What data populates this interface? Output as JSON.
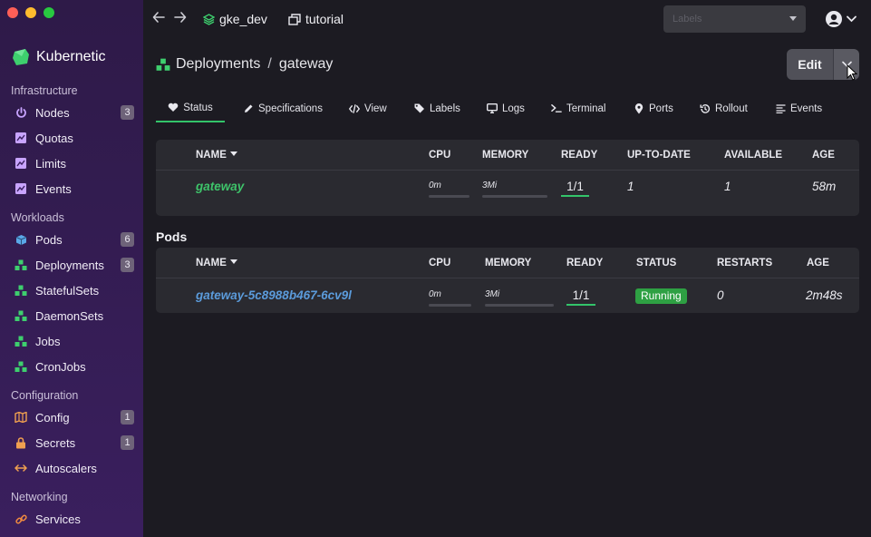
{
  "app": {
    "name": "Kubernetic"
  },
  "colors": {
    "accent": "#33c46a",
    "sidebar": "#3a1f5e",
    "link_green": "#3ec46a",
    "link_blue": "#5b9bdb",
    "running": "#2ea043"
  },
  "sidebar": {
    "sections": [
      {
        "label": "Infrastructure"
      },
      {
        "label": "Workloads"
      },
      {
        "label": "Configuration"
      },
      {
        "label": "Networking"
      }
    ],
    "items": [
      {
        "label": "Nodes",
        "count": "3",
        "icon": "power-icon"
      },
      {
        "label": "Quotas",
        "count": "",
        "icon": "chart-icon"
      },
      {
        "label": "Limits",
        "count": "",
        "icon": "chart-icon"
      },
      {
        "label": "Events",
        "count": "",
        "icon": "chart-icon"
      },
      {
        "label": "Pods",
        "count": "6",
        "icon": "cube-icon"
      },
      {
        "label": "Deployments",
        "count": "3",
        "icon": "cubes-icon"
      },
      {
        "label": "StatefulSets",
        "count": "",
        "icon": "cubes-icon"
      },
      {
        "label": "DaemonSets",
        "count": "",
        "icon": "cubes-icon"
      },
      {
        "label": "Jobs",
        "count": "",
        "icon": "cubes-icon"
      },
      {
        "label": "CronJobs",
        "count": "",
        "icon": "cubes-icon"
      },
      {
        "label": "Config",
        "count": "1",
        "icon": "map-icon"
      },
      {
        "label": "Secrets",
        "count": "1",
        "icon": "lock-icon"
      },
      {
        "label": "Autoscalers",
        "count": "",
        "icon": "arrows-h-icon"
      },
      {
        "label": "Services",
        "count": "",
        "icon": "link-icon"
      }
    ]
  },
  "topbar": {
    "context": "gke_dev",
    "namespace": "tutorial",
    "labels_placeholder": "Labels"
  },
  "header": {
    "kind": "Deployments",
    "separator": "/",
    "name": "gateway",
    "edit_label": "Edit"
  },
  "tabs": [
    {
      "label": "Status",
      "icon": "heartbeat-icon"
    },
    {
      "label": "Specifications",
      "icon": "pencil-icon"
    },
    {
      "label": "View",
      "icon": "code-icon"
    },
    {
      "label": "Labels",
      "icon": "tags-icon"
    },
    {
      "label": "Logs",
      "icon": "monitor-icon"
    },
    {
      "label": "Terminal",
      "icon": "terminal-icon"
    },
    {
      "label": "Ports",
      "icon": "pin-icon"
    },
    {
      "label": "Rollout",
      "icon": "history-icon"
    },
    {
      "label": "Events",
      "icon": "list-icon"
    }
  ],
  "deployment_table": {
    "headers": [
      "NAME",
      "CPU",
      "MEMORY",
      "READY",
      "UP-TO-DATE",
      "AVAILABLE",
      "AGE"
    ],
    "row": {
      "name": "gateway",
      "cpu": "0m",
      "memory": "3Mi",
      "ready": "1/1",
      "up_to_date": "1",
      "available": "1",
      "age": "58m"
    }
  },
  "pods": {
    "title": "Pods",
    "headers": [
      "NAME",
      "CPU",
      "MEMORY",
      "READY",
      "STATUS",
      "RESTARTS",
      "AGE"
    ],
    "row": {
      "name": "gateway-5c8988b467-6cv9l",
      "cpu": "0m",
      "memory": "3Mi",
      "ready": "1/1",
      "status": "Running",
      "restarts": "0",
      "age": "2m48s"
    }
  }
}
